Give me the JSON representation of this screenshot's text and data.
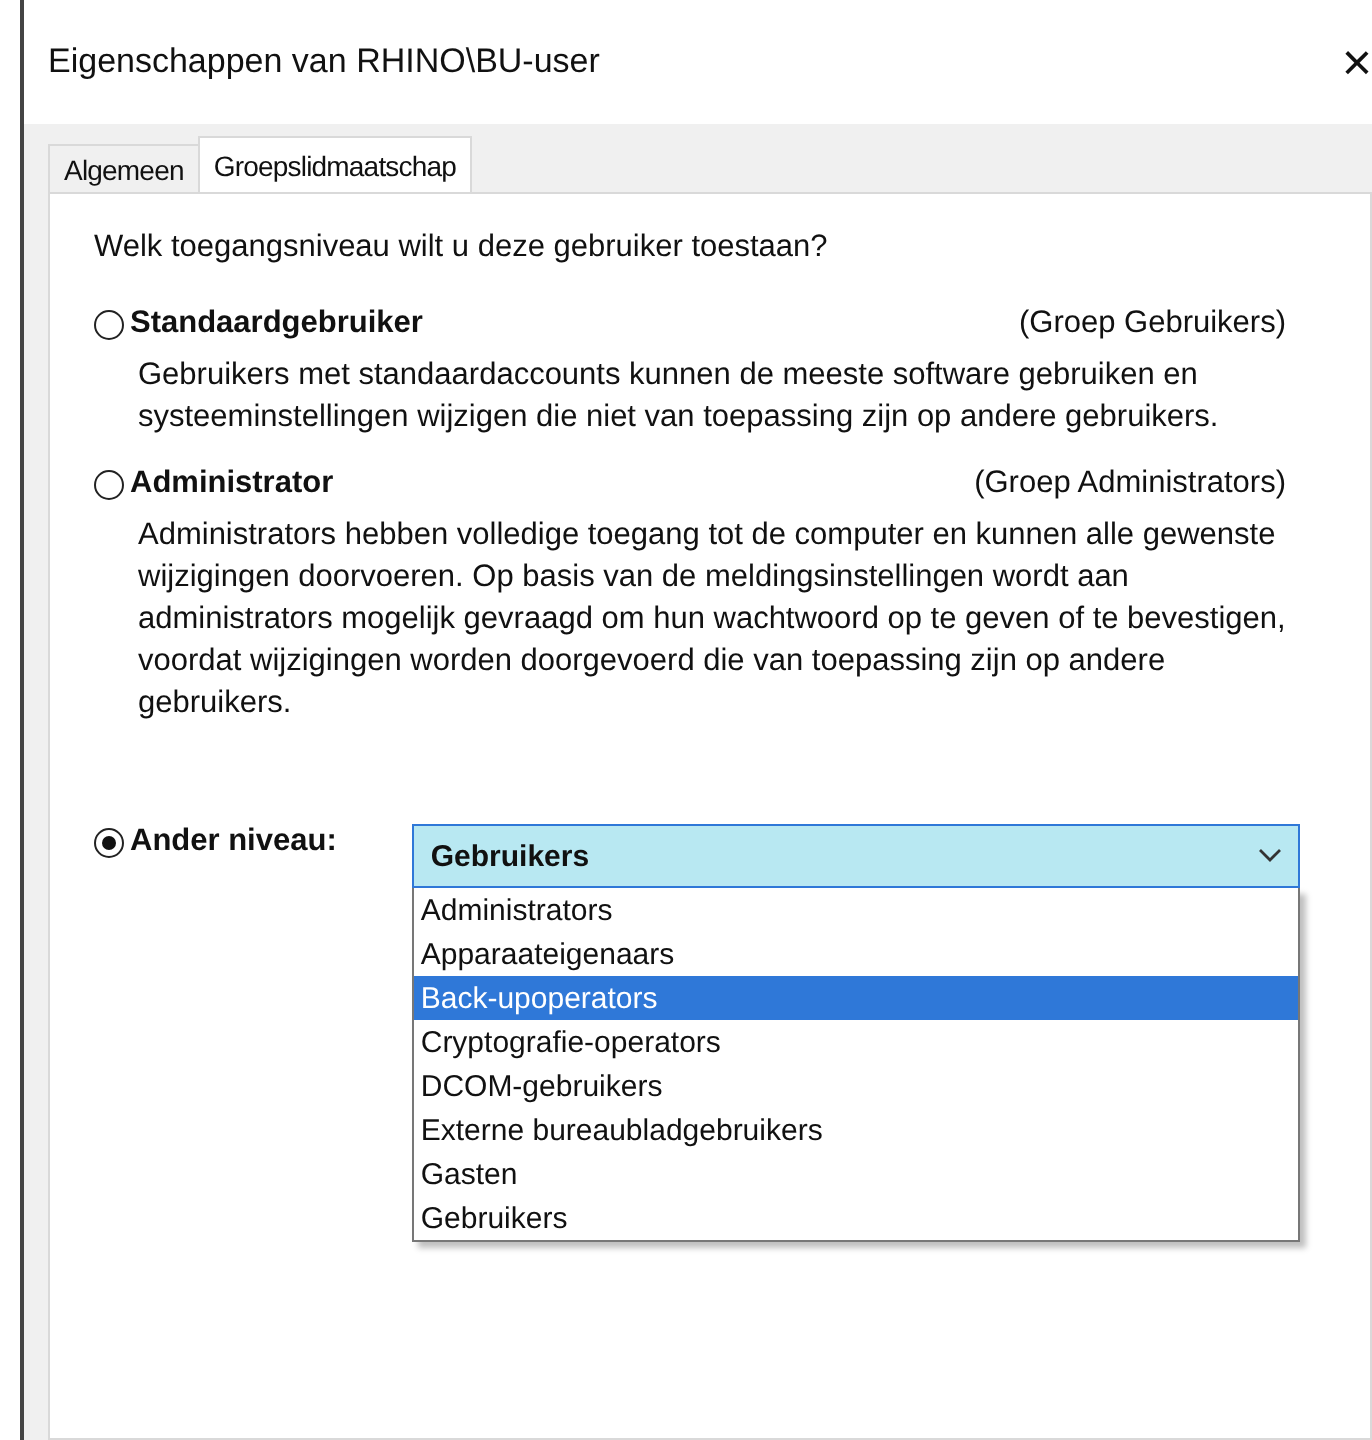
{
  "window": {
    "title": "Eigenschappen van RHINO\\BU-user",
    "close": "×"
  },
  "tabs": [
    {
      "label": "Algemeen",
      "selected": false
    },
    {
      "label": "Groepslidmaatschap",
      "selected": true
    }
  ],
  "question": "Welk toegangsniveau wilt u deze gebruiker toestaan?",
  "options": [
    {
      "kind": "description",
      "label": "Standaardgebruiker",
      "group": "(Groep Gebruikers)",
      "selected": false,
      "description": "Gebruikers met standaardaccounts kunnen de meeste software gebruiken en systeeminstellingen wijzigen die niet van toepassing zijn op andere gebruikers."
    },
    {
      "kind": "description",
      "label": "Administrator",
      "group": "(Groep Administrators)",
      "selected": false,
      "description": "Administrators hebben volledige toegang tot de computer en kunnen alle gewenste wijzigingen doorvoeren. Op basis van de meldingsinstellingen wordt aan administrators mogelijk gevraagd om hun wachtwoord op te geven of te bevestigen, voordat wijzigingen worden doorgevoerd die van toepassing zijn op andere gebruikers."
    },
    {
      "kind": "dropdown",
      "label": "Ander niveau:",
      "selected": true,
      "value": "Gebruikers",
      "expanded": true,
      "items": [
        {
          "label": "Administrators",
          "highlighted": false
        },
        {
          "label": "Apparaateigenaars",
          "highlighted": false
        },
        {
          "label": "Back-upoperators",
          "highlighted": true
        },
        {
          "label": "Cryptografie-operators",
          "highlighted": false
        },
        {
          "label": "DCOM-gebruikers",
          "highlighted": false
        },
        {
          "label": "Externe bureaubladgebruikers",
          "highlighted": false
        },
        {
          "label": "Gasten",
          "highlighted": false
        },
        {
          "label": "Gebruikers",
          "highlighted": false
        }
      ]
    }
  ]
}
